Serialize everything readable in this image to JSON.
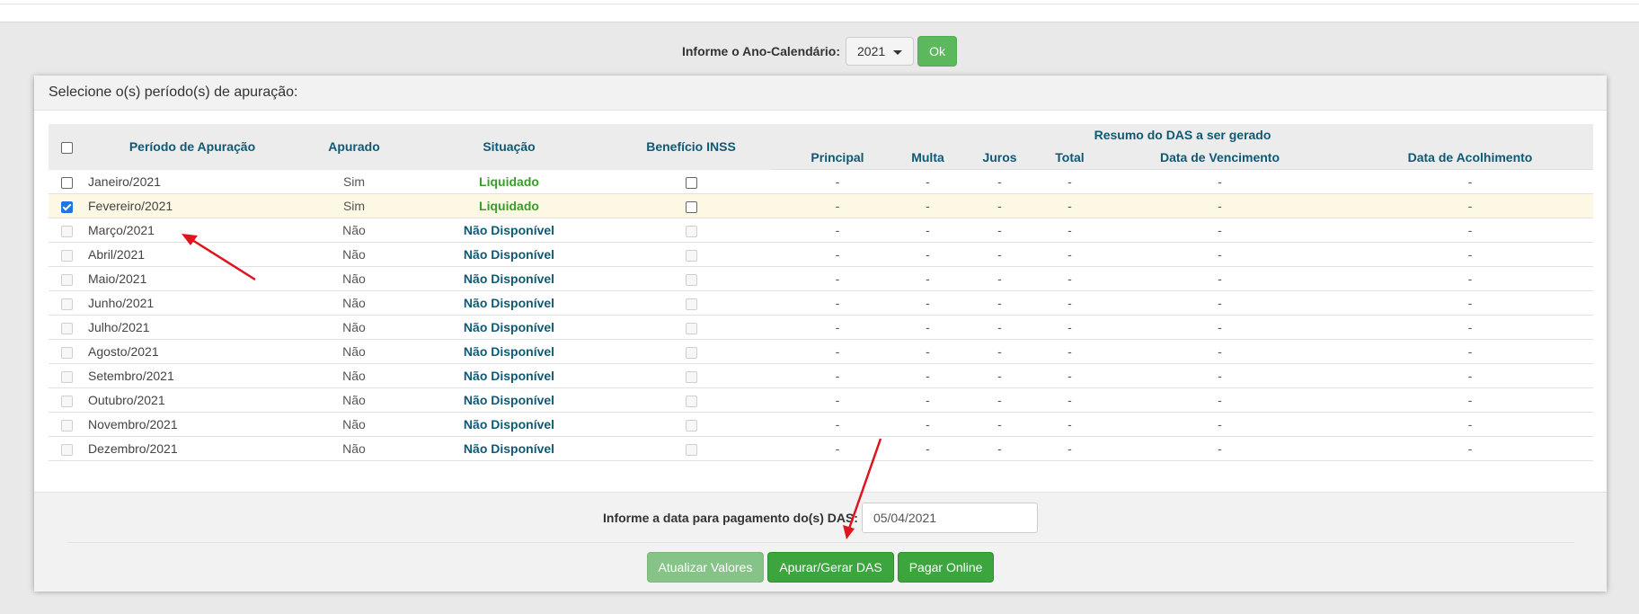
{
  "year_selector": {
    "label": "Informe o Ano-Calendário:",
    "selected_year": "2021",
    "ok_label": "Ok"
  },
  "panel": {
    "title": "Selecione o(s) período(s) de apuração:"
  },
  "table": {
    "headers": {
      "periodo": "Período de Apuração",
      "apurado": "Apurado",
      "situacao": "Situação",
      "beneficio": "Benefício INSS",
      "resumo_group": "Resumo do DAS a ser gerado",
      "principal": "Principal",
      "multa": "Multa",
      "juros": "Juros",
      "total": "Total",
      "vencimento": "Data de Vencimento",
      "acolhimento": "Data de Acolhimento"
    },
    "rows": [
      {
        "periodo": "Janeiro/2021",
        "apurado": "Sim",
        "situacao": "Liquidado",
        "principal": "-",
        "multa": "-",
        "juros": "-",
        "total": "-",
        "vencimento": "-",
        "acolhimento": "-"
      },
      {
        "periodo": "Fevereiro/2021",
        "apurado": "Sim",
        "situacao": "Liquidado",
        "principal": "-",
        "multa": "-",
        "juros": "-",
        "total": "-",
        "vencimento": "-",
        "acolhimento": "-"
      },
      {
        "periodo": "Março/2021",
        "apurado": "Não",
        "situacao": "Não Disponível",
        "principal": "-",
        "multa": "-",
        "juros": "-",
        "total": "-",
        "vencimento": "-",
        "acolhimento": "-"
      },
      {
        "periodo": "Abril/2021",
        "apurado": "Não",
        "situacao": "Não Disponível",
        "principal": "-",
        "multa": "-",
        "juros": "-",
        "total": "-",
        "vencimento": "-",
        "acolhimento": "-"
      },
      {
        "periodo": "Maio/2021",
        "apurado": "Não",
        "situacao": "Não Disponível",
        "principal": "-",
        "multa": "-",
        "juros": "-",
        "total": "-",
        "vencimento": "-",
        "acolhimento": "-"
      },
      {
        "periodo": "Junho/2021",
        "apurado": "Não",
        "situacao": "Não Disponível",
        "principal": "-",
        "multa": "-",
        "juros": "-",
        "total": "-",
        "vencimento": "-",
        "acolhimento": "-"
      },
      {
        "periodo": "Julho/2021",
        "apurado": "Não",
        "situacao": "Não Disponível",
        "principal": "-",
        "multa": "-",
        "juros": "-",
        "total": "-",
        "vencimento": "-",
        "acolhimento": "-"
      },
      {
        "periodo": "Agosto/2021",
        "apurado": "Não",
        "situacao": "Não Disponível",
        "principal": "-",
        "multa": "-",
        "juros": "-",
        "total": "-",
        "vencimento": "-",
        "acolhimento": "-"
      },
      {
        "periodo": "Setembro/2021",
        "apurado": "Não",
        "situacao": "Não Disponível",
        "principal": "-",
        "multa": "-",
        "juros": "-",
        "total": "-",
        "vencimento": "-",
        "acolhimento": "-"
      },
      {
        "periodo": "Outubro/2021",
        "apurado": "Não",
        "situacao": "Não Disponível",
        "principal": "-",
        "multa": "-",
        "juros": "-",
        "total": "-",
        "vencimento": "-",
        "acolhimento": "-"
      },
      {
        "periodo": "Novembro/2021",
        "apurado": "Não",
        "situacao": "Não Disponível",
        "principal": "-",
        "multa": "-",
        "juros": "-",
        "total": "-",
        "vencimento": "-",
        "acolhimento": "-"
      },
      {
        "periodo": "Dezembro/2021",
        "apurado": "Não",
        "situacao": "Não Disponível",
        "principal": "-",
        "multa": "-",
        "juros": "-",
        "total": "-",
        "vencimento": "-",
        "acolhimento": "-"
      }
    ]
  },
  "footer": {
    "payment_date_label": "Informe a data para pagamento do(s) DAS:",
    "payment_date_value": "05/04/2021",
    "buttons": {
      "atualizar": "Atualizar Valores",
      "apurar": "Apurar/Gerar DAS",
      "pagar": "Pagar Online"
    }
  },
  "colors": {
    "header_text": "#0e5a75",
    "liquidado": "#3c9a2f",
    "button_green": "#3da53d",
    "button_disabled": "#86c386",
    "selected_row": "#fcf8e3",
    "annotation_arrow": "#e0141e"
  }
}
